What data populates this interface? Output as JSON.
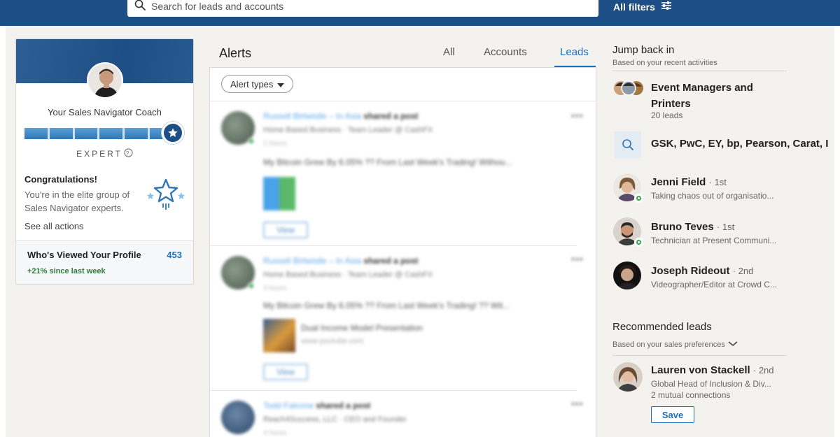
{
  "topbar": {
    "search_placeholder": "Search for leads and accounts",
    "all_filters": "All filters"
  },
  "coach": {
    "title": "Your Sales Navigator Coach",
    "level": "EXPERT",
    "progress_percent": 100,
    "congrats_title": "Congratulations!",
    "congrats_body": "You're in the elite group of Sales Navigator experts.",
    "see_all": "See all actions",
    "who_viewed_label": "Who's Viewed Your Profile",
    "who_viewed_count": "453",
    "who_viewed_delta": "+21% since last week"
  },
  "alerts": {
    "title": "Alerts",
    "tabs": [
      {
        "label": "All"
      },
      {
        "label": "Accounts"
      },
      {
        "label": "Leads"
      }
    ],
    "active_tab": "Leads",
    "alert_types_label": "Alert types",
    "items": [
      {
        "name": "Russell Birtwistle – In Asia",
        "action": "shared a post",
        "headline": "Home Based Business · Team Leader @ CashFX",
        "time": "2 hours",
        "text": "My Bitcoin Grew By 6.05% ?? From Last Week's Trading! Withou...",
        "view_label": "View"
      },
      {
        "name": "Russell Birtwistle – In Asia",
        "action": "shared a post",
        "headline": "Home Based Business · Team Leader @ CashFX",
        "time": "3 hours",
        "text": "My Bitcoin Grew By 6.05% ?? From Last Week's Trading! ?? Wit...",
        "link_title": "Dual Income Model Presentation",
        "link_url": "www.youtube.com",
        "view_label": "View"
      },
      {
        "name": "Todd Falcone",
        "action": "shared a post",
        "headline": "Reach4Success, LLC · CEO and Founder",
        "time": "4 hours"
      }
    ]
  },
  "jump_back": {
    "title": "Jump back in",
    "subtitle": "Based on your recent activities",
    "list": {
      "name": "Event Managers and Printers",
      "count": "20 leads"
    },
    "search": {
      "text": "GSK, PwC, EY, bp, Pearson, Carat, I"
    },
    "people": [
      {
        "name": "Jenni Field",
        "degree": "· 1st",
        "headline": "Taking chaos out of organisatio...",
        "online": true
      },
      {
        "name": "Bruno Teves",
        "degree": "· 1st",
        "headline": "Technician at Present Communi...",
        "online": true
      },
      {
        "name": "Joseph Rideout",
        "degree": "· 2nd",
        "headline": "Videographer/Editor at Crowd C...",
        "online": false
      }
    ]
  },
  "recommended": {
    "title": "Recommended leads",
    "subtitle": "Based on your sales preferences",
    "lead": {
      "name": "Lauren von Stackell",
      "degree": "· 2nd",
      "headline": "Global Head of Inclusion & Div...",
      "mutual": "2 mutual connections",
      "save_label": "Save"
    }
  },
  "colors": {
    "brand_blue": "#1d4f86",
    "link_blue": "#1d6fb8",
    "online_green": "#38a34a"
  }
}
